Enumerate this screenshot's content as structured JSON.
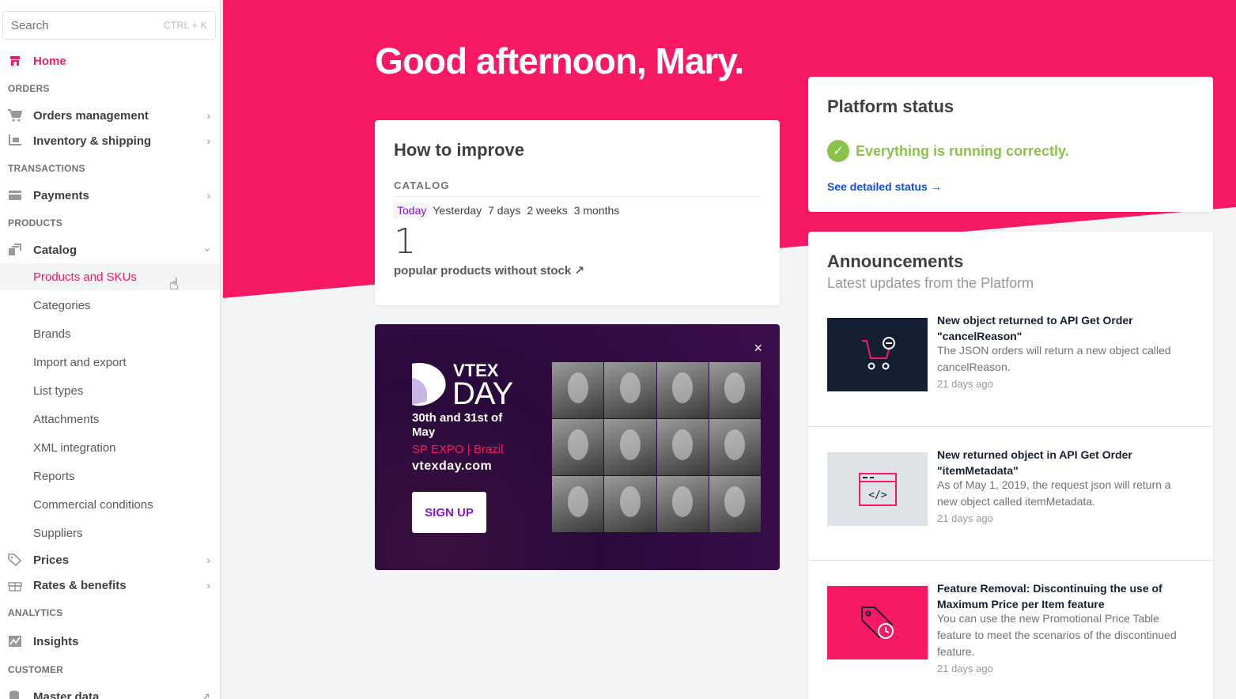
{
  "sidebar": {
    "search": {
      "placeholder": "Search",
      "shortcut": "CTRL + K"
    },
    "home_label": "Home",
    "sections": {
      "orders": "ORDERS",
      "transactions": "TRANSACTIONS",
      "products": "PRODUCTS",
      "analytics": "ANALYTICS",
      "customer": "CUSTOMER"
    },
    "items": {
      "orders_management": "Orders management",
      "inventory_shipping": "Inventory & shipping",
      "payments": "Payments",
      "catalog": "Catalog",
      "prices": "Prices",
      "rates_benefits": "Rates & benefits",
      "insights": "Insights",
      "master_data": "Master data"
    },
    "catalog_sub": [
      "Products and SKUs",
      "Categories",
      "Brands",
      "Import and export",
      "List types",
      "Attachments",
      "XML integration",
      "Reports",
      "Commercial conditions",
      "Suppliers"
    ]
  },
  "main": {
    "greeting_prefix": "Good afternoon, ",
    "greeting_name": "Mary",
    "greeting_suffix": ".",
    "improve": {
      "title": "How to improve",
      "category": "CATALOG",
      "periods": [
        "Today",
        "Yesterday",
        "7 days",
        "2 weeks",
        "3 months"
      ],
      "selected_period": "Today",
      "value": "1",
      "caption": "popular products without stock ↗"
    },
    "promo": {
      "brand": "VTEX",
      "event": "DAY",
      "dates": "30th and 31st of May",
      "location": "SP EXPO | Brazil",
      "url": "vtexday.com",
      "cta": "SIGN UP",
      "close": "×"
    },
    "status": {
      "title": "Platform status",
      "message": "Everything is running correctly.",
      "link": "See detailed status →"
    },
    "announcements": {
      "title": "Announcements",
      "subtitle": "Latest updates from the Platform",
      "items": [
        {
          "title": "New object returned to API Get Order \"cancelReason\"",
          "desc": "The JSON orders will return a new object called cancelReason.",
          "time": "21 days ago"
        },
        {
          "title": "New returned object in API Get Order \"itemMetadata\"",
          "desc": "As of May 1, 2019, the request json will return a new object called itemMetadata.",
          "time": "21 days ago"
        },
        {
          "title": "Feature Removal: Discontinuing the use of Maximum Price per Item feature",
          "desc": "You can use the new Promotional Price Table feature to meet the scenarios of the discontinued feature.",
          "time": "21 days ago"
        }
      ]
    }
  },
  "colors": {
    "brand_pink": "#f71963",
    "success": "#8bc34a",
    "link": "#134cd8",
    "purple": "#8914cc"
  }
}
